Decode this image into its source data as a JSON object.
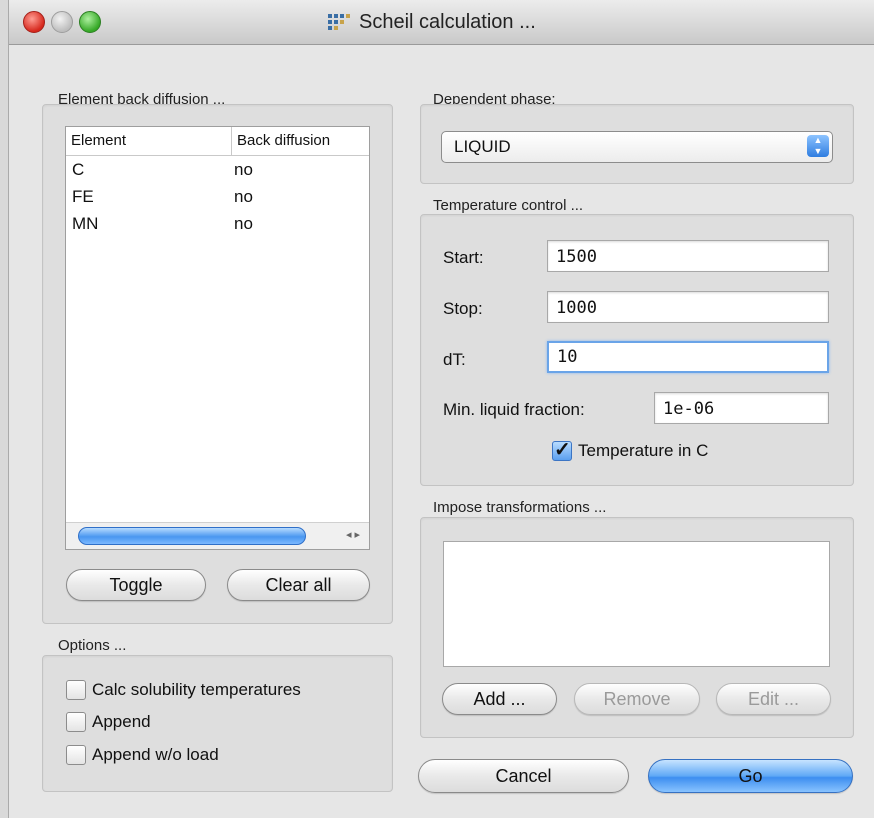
{
  "window": {
    "title": "Scheil calculation ..."
  },
  "back_diffusion": {
    "group_label": "Element back diffusion ...",
    "columns": [
      "Element",
      "Back diffusion"
    ],
    "rows": [
      {
        "element": "C",
        "back_diffusion": "no"
      },
      {
        "element": "FE",
        "back_diffusion": "no"
      },
      {
        "element": "MN",
        "back_diffusion": "no"
      }
    ],
    "toggle_label": "Toggle",
    "clear_all_label": "Clear all"
  },
  "options": {
    "group_label": "Options ...",
    "calc_solubility_label": "Calc solubility temperatures",
    "append_label": "Append",
    "append_wo_load_label": "Append w/o load"
  },
  "dependent_phase": {
    "group_label": "Dependent phase:",
    "selected": "LIQUID"
  },
  "temperature": {
    "group_label": "Temperature control ...",
    "start_label": "Start:",
    "start_value": "1500",
    "stop_label": "Stop:",
    "stop_value": "1000",
    "dt_label": "dT:",
    "dt_value": "10",
    "min_liquid_label": "Min. liquid fraction:",
    "min_liquid_value": "1e-06",
    "in_c_label": "Temperature in C"
  },
  "transformations": {
    "group_label": "Impose transformations ...",
    "add_label": "Add ...",
    "remove_label": "Remove",
    "edit_label": "Edit ..."
  },
  "actions": {
    "cancel_label": "Cancel",
    "go_label": "Go"
  }
}
